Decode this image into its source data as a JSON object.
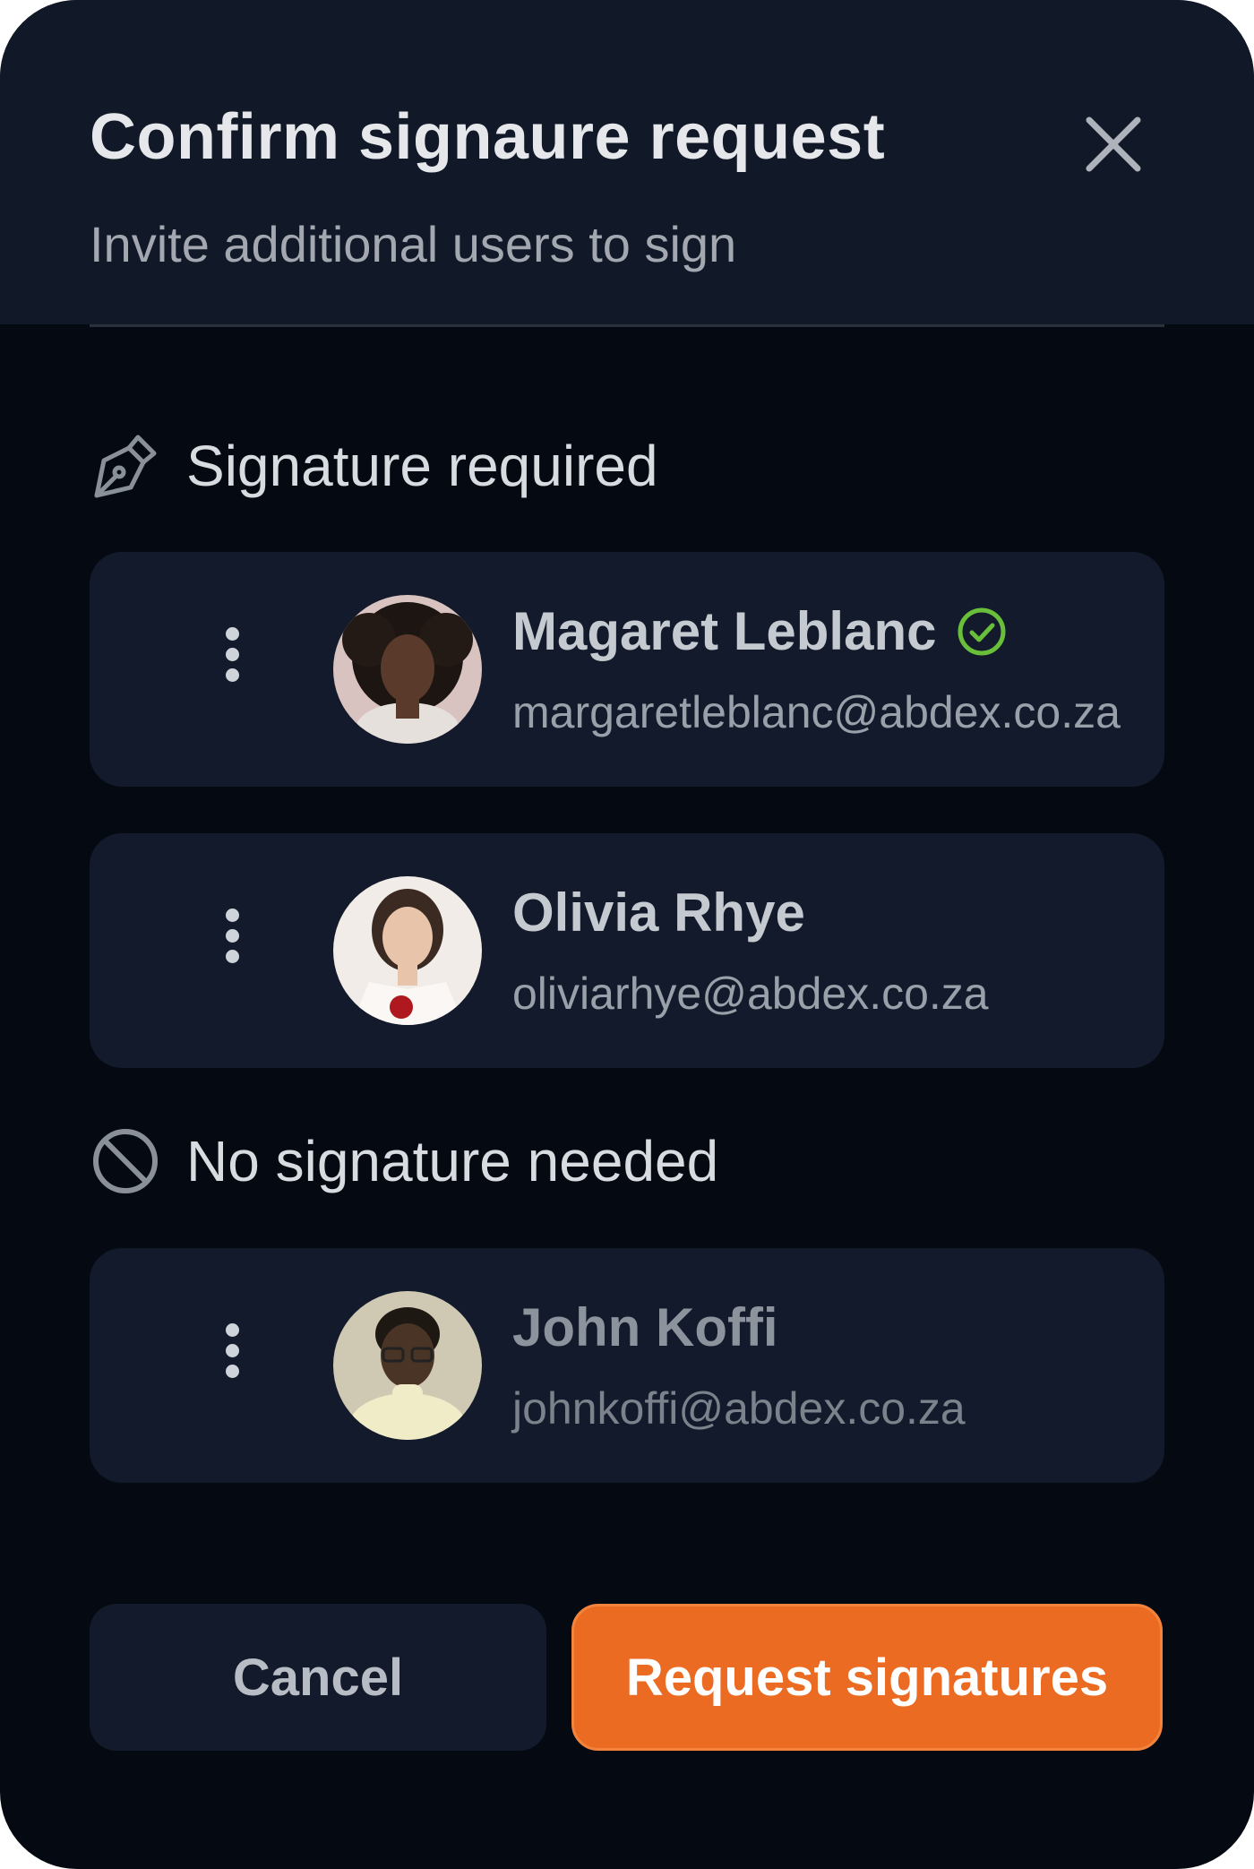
{
  "dialog": {
    "title": "Confirm signaure request",
    "subtitle": "Invite additional users to sign"
  },
  "sections": {
    "required": {
      "label": "Signature required",
      "icon": "pen-tool-icon",
      "people": [
        {
          "name": "Magaret Leblanc",
          "email": "margaretleblanc@abdex.co.za",
          "verified": true
        },
        {
          "name": "Olivia Rhye",
          "email": "oliviarhye@abdex.co.za",
          "verified": false
        }
      ]
    },
    "not_needed": {
      "label": "No signature needed",
      "icon": "prohibited-icon",
      "people": [
        {
          "name": "John Koffi",
          "email": "johnkoffi@abdex.co.za",
          "verified": false
        }
      ]
    }
  },
  "actions": {
    "cancel_label": "Cancel",
    "submit_label": "Request signatures"
  },
  "colors": {
    "accent": "#ec6b22",
    "verified": "#6abf3a",
    "background": "#050a12",
    "card": "#121a2b"
  }
}
